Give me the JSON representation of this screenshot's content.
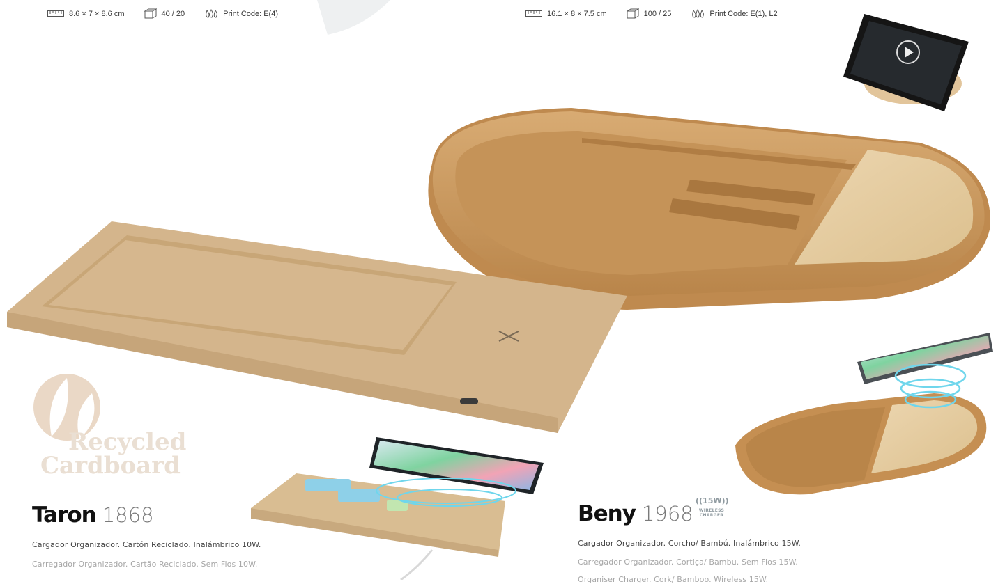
{
  "left_specs": {
    "size": "8.6 × 7 × 8.6 cm",
    "packing": "40 / 20",
    "print": "Print Code: E(4)"
  },
  "right_specs": {
    "size": "16.1 × 8 × 7.5 cm",
    "packing": "100 / 25",
    "print": "Print Code: E(1), L2"
  },
  "logo": {
    "line1": "Recycled",
    "line2": "Cardboard"
  },
  "taron": {
    "name": "Taron",
    "code": "1868",
    "desc_es": "Cargador Organizador. Cartón Reciclado. Inalámbrico 10W.",
    "desc_pt": "Carregador Organizador. Cartão Reciclado. Sem Fios 10W."
  },
  "beny": {
    "name": "Beny",
    "code": "1968",
    "badge_power": "((15W))",
    "badge_line1": "WIRELESS",
    "badge_line2": "CHARGER",
    "desc_es": "Cargador Organizador. Corcho/ Bambú. Inalámbrico 15W.",
    "desc_pt": "Carregador Organizador. Cortiça/ Bambu. Sem Fios 15W.",
    "desc_en": "Organiser Charger. Cork/ Bamboo. Wireless 15W."
  },
  "colors": {
    "cork": "#c99a5f",
    "cardboard": "#d2b48c",
    "bamboo": "#e3c89b",
    "charging_ring": "#6fd6ec"
  },
  "icons": [
    "ruler-icon",
    "box-icon",
    "print-drops-icon",
    "play-icon",
    "wireless-icon"
  ]
}
